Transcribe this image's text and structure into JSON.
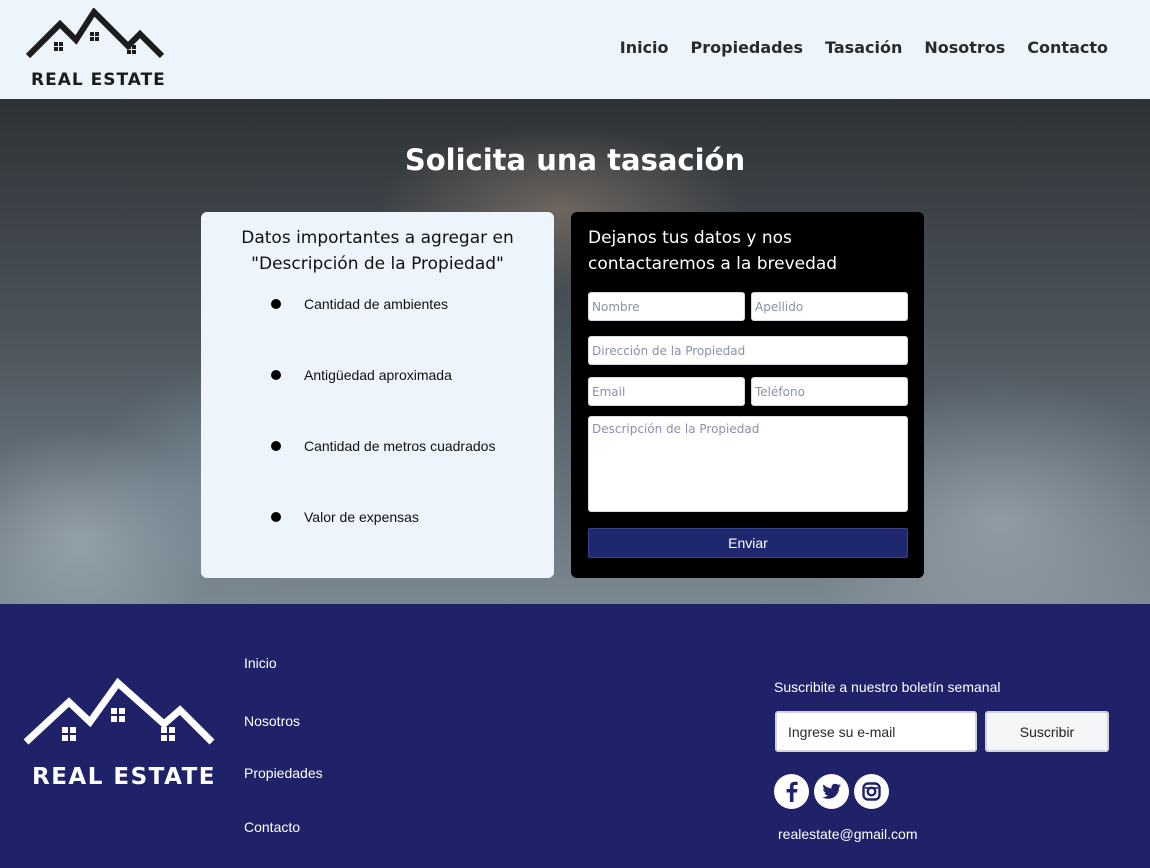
{
  "header": {
    "logo_text": "REAL ESTATE",
    "nav": [
      "Inicio",
      "Propiedades",
      "Tasación",
      "Nosotros",
      "Contacto"
    ]
  },
  "hero": {
    "title": "Solicita una tasación",
    "info_card": {
      "title": "Datos importantes a agregar en \"Descripción de la Propiedad\"",
      "items": [
        "Cantidad de ambientes",
        "Antigüedad aproximada",
        "Cantidad de metros cuadrados",
        "Valor de expensas"
      ]
    },
    "form_card": {
      "title": "Dejanos tus datos y nos contactaremos a la brevedad",
      "placeholders": {
        "nombre": "Nombre",
        "apellido": "Apellido",
        "direccion": "Dirección de la Propiedad",
        "email": "Email",
        "telefono": "Teléfono",
        "descripcion": "Descripción de la Propiedad"
      },
      "submit_label": "Enviar"
    }
  },
  "footer": {
    "logo_text": "REAL ESTATE",
    "links": [
      "Inicio",
      "Nosotros",
      "Propiedades",
      "Contacto"
    ],
    "newsletter_label": "Suscribite a nuestro boletín semanal",
    "email_placeholder": "Ingrese su e-mail",
    "subscribe_label": "Suscribir",
    "social_icons": [
      "facebook-icon",
      "twitter-icon",
      "instagram-icon"
    ],
    "contact_email": "realestate@gmail.com"
  },
  "colors": {
    "header_bg": "#eef4fc",
    "footer_bg": "#1f2268",
    "button_bg": "#1f276e",
    "form_card_bg": "#000000"
  }
}
